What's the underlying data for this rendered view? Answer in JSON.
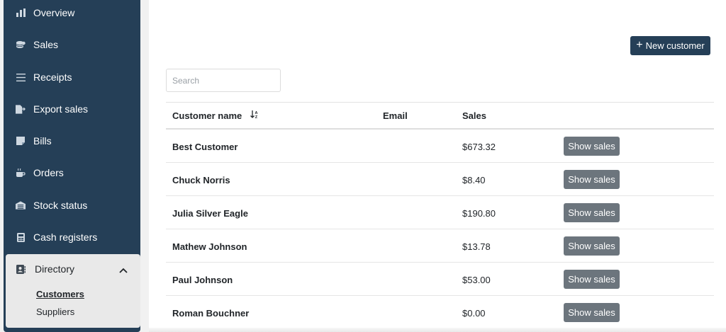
{
  "sidebar": {
    "items": [
      {
        "label": "Overview",
        "icon": "bar-chart-icon"
      },
      {
        "label": "Sales",
        "icon": "coins-icon"
      },
      {
        "label": "Receipts",
        "icon": "list-icon"
      },
      {
        "label": "Export sales",
        "icon": "file-export-icon"
      },
      {
        "label": "Bills",
        "icon": "note-icon"
      },
      {
        "label": "Orders",
        "icon": "mug-icon"
      },
      {
        "label": "Stock status",
        "icon": "warehouse-icon"
      },
      {
        "label": "Cash registers",
        "icon": "calculator-icon"
      }
    ],
    "directory": {
      "label": "Directory",
      "icon": "contact-book-icon",
      "expanded": true,
      "sub_items": [
        {
          "label": "Customers",
          "active": true
        },
        {
          "label": "Suppliers",
          "active": false
        }
      ]
    }
  },
  "main": {
    "new_customer_button": {
      "icon": "+",
      "label": "New customer"
    },
    "search": {
      "placeholder": "Search",
      "value": ""
    },
    "table": {
      "columns": [
        "Customer name",
        "Email",
        "Sales"
      ],
      "sort_column": "Customer name",
      "rows": [
        {
          "name": "Best Customer",
          "email": "",
          "sales": "$673.32",
          "action": "Show sales"
        },
        {
          "name": "Chuck Norris",
          "email": "",
          "sales": "$8.40",
          "action": "Show sales"
        },
        {
          "name": "Julia Silver Eagle",
          "email": "",
          "sales": "$190.80",
          "action": "Show sales"
        },
        {
          "name": "Mathew Johnson",
          "email": "",
          "sales": "$13.78",
          "action": "Show sales"
        },
        {
          "name": "Paul Johnson",
          "email": "",
          "sales": "$53.00",
          "action": "Show sales"
        },
        {
          "name": "Roman Bouchner",
          "email": "",
          "sales": "$0.00",
          "action": "Show sales"
        }
      ]
    }
  },
  "colors": {
    "sidebar": "#253f57",
    "primary_button": "#253f57",
    "secondary_button": "#6c757d",
    "directory_panel": "#e9e9e9"
  }
}
